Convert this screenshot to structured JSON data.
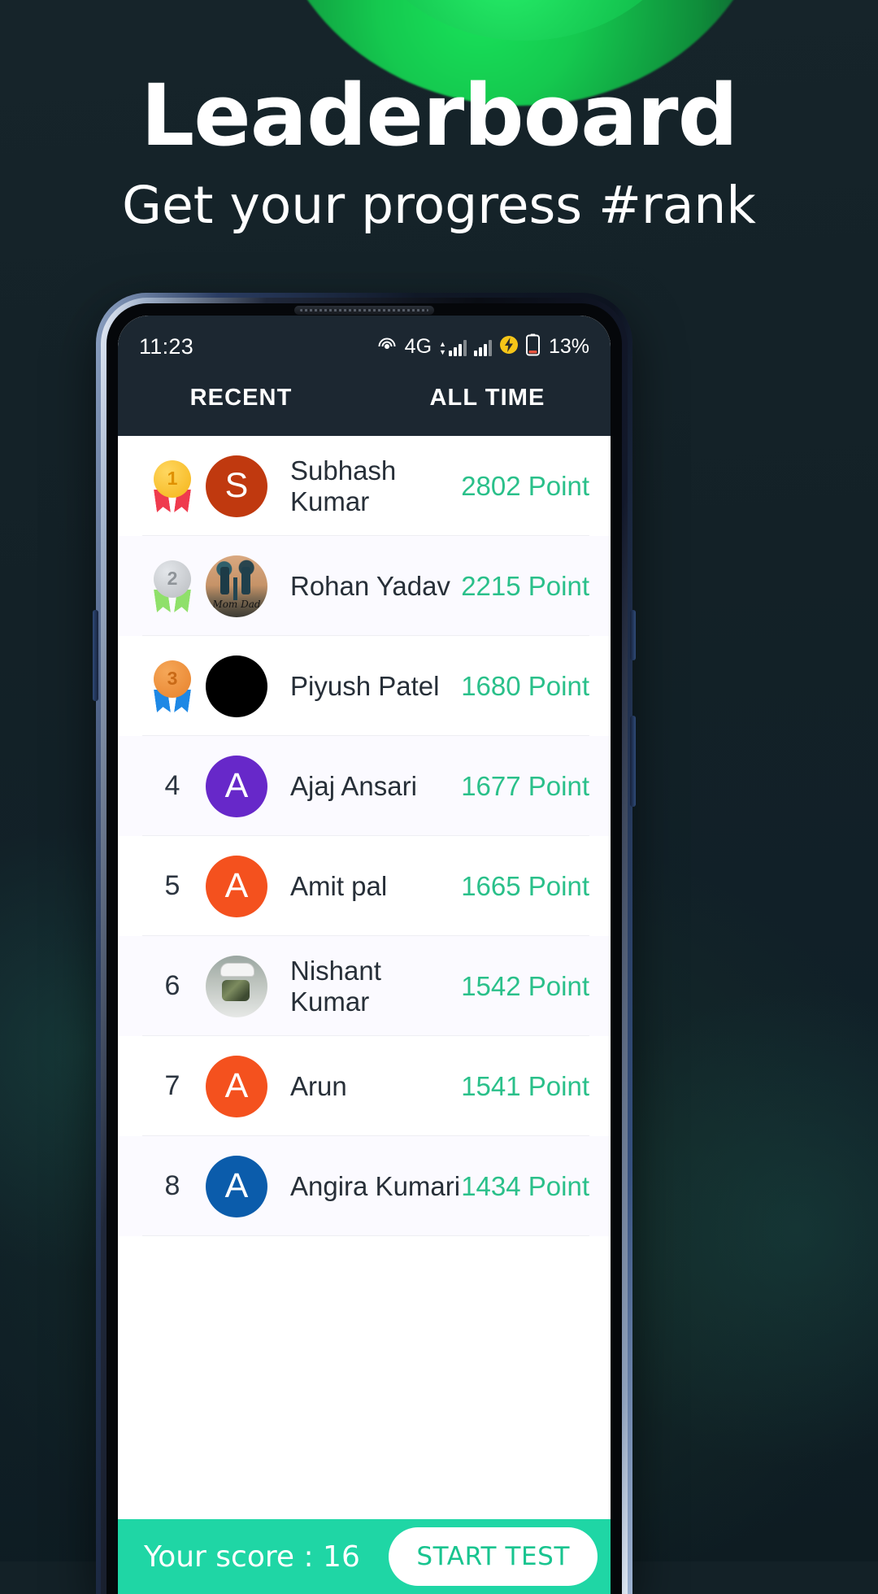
{
  "promo": {
    "title": "Leaderboard",
    "subtitle": "Get your progress #rank"
  },
  "statusbar": {
    "time": "11:23",
    "network": "4G",
    "battery_percent": "13%",
    "icons": [
      "hotspot-icon",
      "signal-bars-icon",
      "signal-bars-secondary-icon",
      "charging-bolt-icon",
      "battery-icon"
    ]
  },
  "tabs": [
    {
      "label": "RECENT",
      "active": true
    },
    {
      "label": "ALL TIME",
      "active": false
    }
  ],
  "colors": {
    "accent_green": "#1fd6a5",
    "points_green": "#2ac08a",
    "header_dark": "#1c2731",
    "promo_bg": "#132127",
    "blob_green": "#15c94f"
  },
  "leaderboard": [
    {
      "rank": "1",
      "medal": "gold",
      "name": "Subhash Kumar",
      "points": "2802 Point",
      "avatar_type": "initial",
      "initial": "S",
      "avatar_color": "#c0390f"
    },
    {
      "rank": "2",
      "medal": "silver",
      "name": "Rohan Yadav",
      "points": "2215 Point",
      "avatar_type": "photo-tattoo",
      "initial": "",
      "avatar_color": ""
    },
    {
      "rank": "3",
      "medal": "bronze",
      "name": "Piyush Patel",
      "points": "1680 Point",
      "avatar_type": "photo-black",
      "initial": "",
      "avatar_color": "#000000"
    },
    {
      "rank": "4",
      "medal": "",
      "name": "Ajaj Ansari",
      "points": "1677 Point",
      "avatar_type": "initial",
      "initial": "A",
      "avatar_color": "#6728c9"
    },
    {
      "rank": "5",
      "medal": "",
      "name": "Amit pal",
      "points": "1665 Point",
      "avatar_type": "initial",
      "initial": "A",
      "avatar_color": "#f4511e"
    },
    {
      "rank": "6",
      "medal": "",
      "name": "Nishant Kumar",
      "points": "1542 Point",
      "avatar_type": "photo-kid",
      "initial": "",
      "avatar_color": ""
    },
    {
      "rank": "7",
      "medal": "",
      "name": "Arun",
      "points": "1541 Point",
      "avatar_type": "initial",
      "initial": "A",
      "avatar_color": "#f4511e"
    },
    {
      "rank": "8",
      "medal": "",
      "name": "Angira Kumari",
      "points": "1434 Point",
      "avatar_type": "initial",
      "initial": "A",
      "avatar_color": "#0b5cab"
    }
  ],
  "bottom_bar": {
    "score_label": "Your score : 16",
    "start_button": "START TEST"
  },
  "medal_styles": {
    "gold": {
      "disc": "#f5b417",
      "disc2": "#ffd760",
      "ribbon": "#ef3b4e",
      "num": "#e09100"
    },
    "silver": {
      "disc": "#b9bcc0",
      "disc2": "#e3e6ea",
      "ribbon": "#8fe06a",
      "num": "#8f9499"
    },
    "bronze": {
      "disc": "#e8822c",
      "disc2": "#f5a758",
      "ribbon": "#1e88e5",
      "num": "#c96a17"
    }
  }
}
